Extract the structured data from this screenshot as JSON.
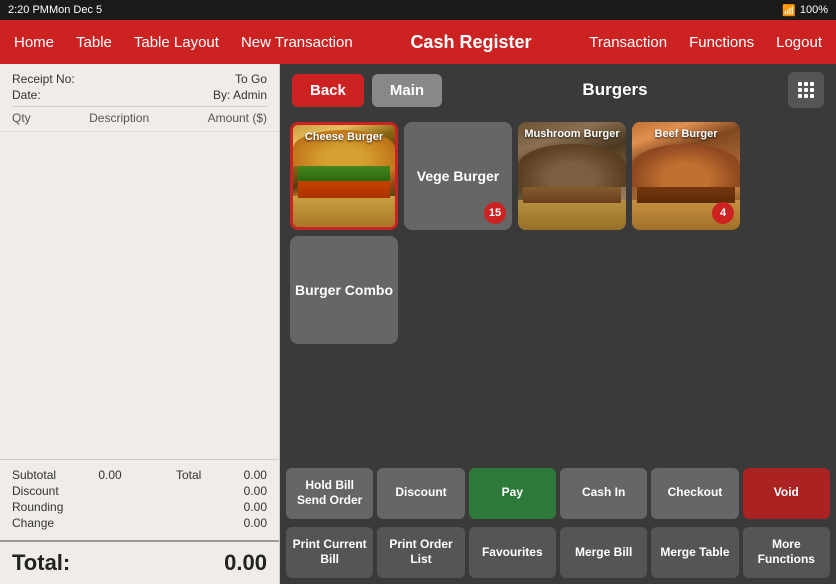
{
  "status_bar": {
    "time": "2:20 PM",
    "date": "Mon Dec 5",
    "wifi": "WiFi",
    "battery": "100%"
  },
  "nav": {
    "title": "Cash Register",
    "left_items": [
      "Home",
      "Table",
      "Table Layout",
      "New Transaction"
    ],
    "right_items": [
      "Transaction",
      "Functions",
      "Logout"
    ]
  },
  "receipt": {
    "receipt_no_label": "Receipt No:",
    "receipt_no_value": "",
    "to_go_label": "To Go",
    "date_label": "Date:",
    "by_admin_label": "By: Admin",
    "qty_label": "Qty",
    "description_label": "Description",
    "amount_label": "Amount ($)",
    "subtotal_label": "Subtotal",
    "subtotal_value": "0.00",
    "discount_label": "Discount",
    "discount_value": "0.00",
    "rounding_label": "Rounding",
    "rounding_value": "0.00",
    "change_label": "Change",
    "change_value": "0.00",
    "total_label_side": "Total",
    "total_value_side": "0.00",
    "total_label": "Total:",
    "total_amount": "0.00"
  },
  "category": {
    "title": "Burgers",
    "back_label": "Back",
    "main_label": "Main"
  },
  "products": [
    {
      "id": "cheese-burger",
      "name": "Cheese Burger",
      "type": "image",
      "selected": true,
      "badge": null
    },
    {
      "id": "vege-burger",
      "name": "Vege Burger",
      "type": "text",
      "selected": false,
      "badge": "15"
    },
    {
      "id": "mushroom-burger",
      "name": "Mushroom Burger",
      "type": "image",
      "selected": false,
      "badge": null
    },
    {
      "id": "beef-burger",
      "name": "Beef Burger",
      "type": "image",
      "selected": false,
      "badge": "4"
    },
    {
      "id": "burger-combo",
      "name": "Burger Combo",
      "type": "text",
      "selected": false,
      "badge": null
    }
  ],
  "action_buttons": [
    {
      "id": "hold-bill-send-order",
      "label": "Hold Bill\nSend Order",
      "style": "gray"
    },
    {
      "id": "discount",
      "label": "Discount",
      "style": "gray"
    },
    {
      "id": "pay",
      "label": "Pay",
      "style": "green"
    },
    {
      "id": "cash-in",
      "label": "Cash In",
      "style": "gray"
    },
    {
      "id": "checkout",
      "label": "Checkout",
      "style": "gray"
    },
    {
      "id": "void",
      "label": "Void",
      "style": "red"
    }
  ],
  "bottom_buttons": [
    {
      "id": "print-current-bill",
      "label": "Print Current Bill",
      "style": "dark-gray"
    },
    {
      "id": "print-order-list",
      "label": "Print Order List",
      "style": "dark-gray"
    },
    {
      "id": "favourites",
      "label": "Favourites",
      "style": "dark-gray"
    },
    {
      "id": "merge-bill",
      "label": "Merge Bill",
      "style": "dark-gray"
    },
    {
      "id": "merge-table",
      "label": "Merge Table",
      "style": "dark-gray"
    },
    {
      "id": "more-functions",
      "label": "More Functions",
      "style": "dark-gray"
    }
  ]
}
